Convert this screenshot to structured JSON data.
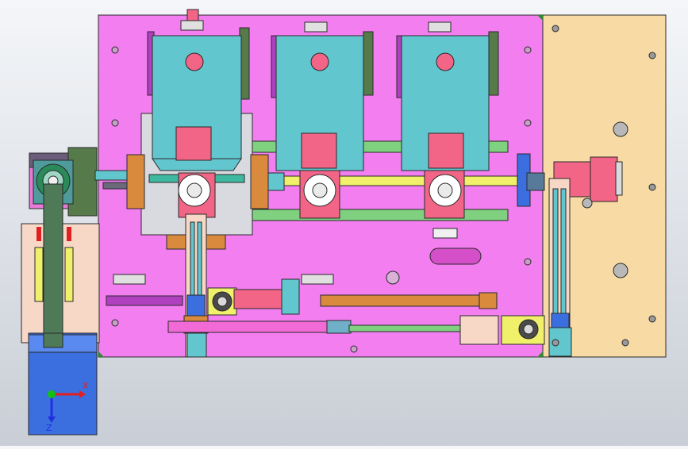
{
  "viewport": {
    "background_top": "#f4f6f9",
    "background_bottom": "#c9ced6"
  },
  "triad": {
    "x_label": "X",
    "z_label": "Z",
    "x_color": "#e02020",
    "y_color": "#12c012",
    "z_color": "#2030e0"
  },
  "palette": {
    "main_plate": "#f37ef0",
    "right_plate": "#f8dba4",
    "left_plate": "#f7d7c6",
    "carriage_teal": "#62c6cf",
    "motor_pink": "#f26586",
    "rail_green": "#7fd07f",
    "shaft_yellow": "#f0f06a",
    "cylinder_orange": "#d98a3c",
    "blue_base": "#3b6fe0",
    "bracket_olive": "#577a4a",
    "edge": "#2a2a2a"
  }
}
